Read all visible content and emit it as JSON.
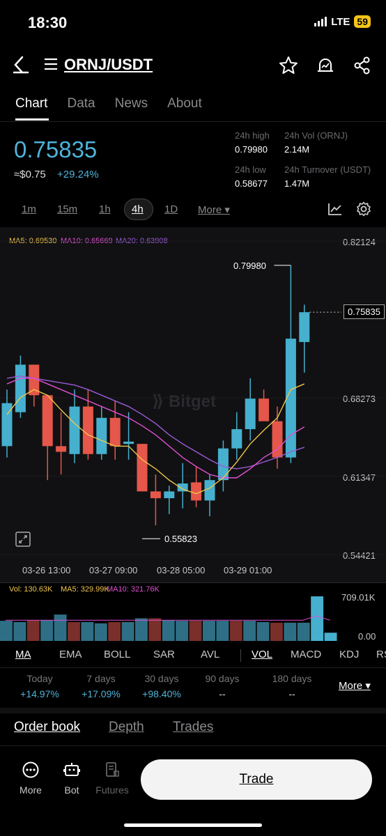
{
  "status": {
    "time": "18:30",
    "network": "LTE",
    "battery": "59"
  },
  "header": {
    "pair": "ORNJ/USDT",
    "icons": [
      "back-icon",
      "menu-icon",
      "star-icon",
      "price-alert-icon",
      "share-icon"
    ]
  },
  "tabs": [
    "Chart",
    "Data",
    "News",
    "About"
  ],
  "price": {
    "last": "0.75835",
    "usd": "≈$0.75",
    "change": "+29.24%"
  },
  "stats": {
    "high_label": "24h high",
    "high": "0.79980",
    "vol_label": "24h Vol (ORNJ)",
    "vol": "2.14M",
    "low_label": "24h low",
    "low": "0.58677",
    "turnover_label": "24h Turnover (USDT)",
    "turnover": "1.47M"
  },
  "intervals": [
    "1m",
    "15m",
    "1h",
    "4h",
    "1D",
    "More ▾"
  ],
  "ma_legend": {
    "ma5": "MA5: 0.69530",
    "ma10": "MA10: 0.65669",
    "ma20": "MA20: 0.63908"
  },
  "watermark": "Bitget",
  "colors": {
    "up": "#46b0ce",
    "down": "#e5574a",
    "ma5": "#f0c54a",
    "ma10": "#e04fd1",
    "ma20": "#9b5bd6",
    "accent": "#4fb3d9"
  },
  "chart_data": {
    "type": "candlestick",
    "y_axis_labels": [
      "0.82124",
      "0.75835",
      "0.68273",
      "0.61347",
      "0.54421"
    ],
    "x_axis_labels": [
      "03-26 13:00",
      "03-27 09:00",
      "03-28 05:00",
      "03-29 01:00"
    ],
    "ylim": [
      0.54421,
      0.82124
    ],
    "high_annotation": "0.79980",
    "low_annotation": "0.55823",
    "last_price_label": "0.75835",
    "candles": [
      {
        "o": 0.64,
        "h": 0.69,
        "l": 0.63,
        "c": 0.678
      },
      {
        "o": 0.67,
        "h": 0.72,
        "l": 0.665,
        "c": 0.712
      },
      {
        "o": 0.712,
        "h": 0.712,
        "l": 0.675,
        "c": 0.685
      },
      {
        "o": 0.685,
        "h": 0.685,
        "l": 0.61,
        "c": 0.64
      },
      {
        "o": 0.64,
        "h": 0.67,
        "l": 0.615,
        "c": 0.635
      },
      {
        "o": 0.633,
        "h": 0.69,
        "l": 0.625,
        "c": 0.675
      },
      {
        "o": 0.675,
        "h": 0.69,
        "l": 0.628,
        "c": 0.633
      },
      {
        "o": 0.633,
        "h": 0.675,
        "l": 0.628,
        "c": 0.665
      },
      {
        "o": 0.665,
        "h": 0.68,
        "l": 0.628,
        "c": 0.64
      },
      {
        "o": 0.642,
        "h": 0.67,
        "l": 0.628,
        "c": 0.644
      },
      {
        "o": 0.642,
        "h": 0.642,
        "l": 0.6,
        "c": 0.6
      },
      {
        "o": 0.6,
        "h": 0.615,
        "l": 0.57,
        "c": 0.594
      },
      {
        "o": 0.594,
        "h": 0.605,
        "l": 0.58,
        "c": 0.6
      },
      {
        "o": 0.6,
        "h": 0.625,
        "l": 0.585,
        "c": 0.607
      },
      {
        "o": 0.608,
        "h": 0.622,
        "l": 0.586,
        "c": 0.592
      },
      {
        "o": 0.592,
        "h": 0.615,
        "l": 0.578,
        "c": 0.61
      },
      {
        "o": 0.61,
        "h": 0.645,
        "l": 0.6,
        "c": 0.638
      },
      {
        "o": 0.638,
        "h": 0.67,
        "l": 0.628,
        "c": 0.655
      },
      {
        "o": 0.655,
        "h": 0.7,
        "l": 0.645,
        "c": 0.682
      },
      {
        "o": 0.682,
        "h": 0.69,
        "l": 0.665,
        "c": 0.662
      },
      {
        "o": 0.662,
        "h": 0.675,
        "l": 0.62,
        "c": 0.63
      },
      {
        "o": 0.63,
        "h": 0.7998,
        "l": 0.625,
        "c": 0.735
      },
      {
        "o": 0.732,
        "h": 0.765,
        "l": 0.705,
        "c": 0.75835
      }
    ],
    "ma5": [
      0.668,
      0.683,
      0.69,
      0.685,
      0.672,
      0.66,
      0.65,
      0.645,
      0.64,
      0.64,
      0.628,
      0.62,
      0.61,
      0.602,
      0.598,
      0.603,
      0.612,
      0.626,
      0.642,
      0.654,
      0.665,
      0.69,
      0.695
    ],
    "ma10": [
      0.695,
      0.7,
      0.7,
      0.695,
      0.69,
      0.685,
      0.68,
      0.675,
      0.67,
      0.665,
      0.658,
      0.65,
      0.64,
      0.63,
      0.622,
      0.615,
      0.612,
      0.612,
      0.62,
      0.63,
      0.637,
      0.65,
      0.657
    ],
    "ma20": [
      0.7,
      0.702,
      0.7,
      0.698,
      0.696,
      0.694,
      0.69,
      0.685,
      0.68,
      0.675,
      0.668,
      0.66,
      0.65,
      0.642,
      0.635,
      0.628,
      0.622,
      0.62,
      0.622,
      0.626,
      0.63,
      0.635,
      0.639
    ],
    "volume": {
      "legend": {
        "vol": "Vol: 130.63K",
        "ma5": "MA5: 329.99K",
        "ma10": "MA10: 321.76K"
      },
      "axis_labels": [
        "709.01K",
        "0.00"
      ],
      "max": 709010,
      "values": [
        320000,
        300000,
        330000,
        330000,
        420000,
        300000,
        300000,
        280000,
        300000,
        300000,
        360000,
        360000,
        330000,
        320000,
        320000,
        320000,
        320000,
        320000,
        320000,
        300000,
        290000,
        290000,
        290000,
        709010,
        130630
      ]
    }
  },
  "indicators": [
    "MA",
    "EMA",
    "BOLL",
    "SAR",
    "AVL",
    "VOL",
    "MACD",
    "KDJ",
    "RS"
  ],
  "performance": [
    {
      "label": "Today",
      "value": "+14.97%"
    },
    {
      "label": "7 days",
      "value": "+17.09%"
    },
    {
      "label": "30 days",
      "value": "+98.40%"
    },
    {
      "label": "90 days",
      "value": "--"
    },
    {
      "label": "180 days",
      "value": "--"
    }
  ],
  "performance_more": "More ▾",
  "bottom_tabs": [
    "Order book",
    "Depth",
    "Trades"
  ],
  "nav": [
    {
      "label": "More",
      "icon": "more-icon"
    },
    {
      "label": "Bot",
      "icon": "bot-icon"
    },
    {
      "label": "Futures",
      "icon": "futures-icon"
    }
  ],
  "trade_button": "Trade"
}
